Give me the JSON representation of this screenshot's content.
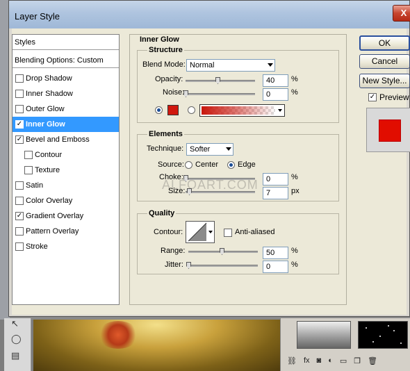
{
  "dialog": {
    "title": "Layer Style",
    "close_glyph": "X"
  },
  "styles_list": {
    "header": "Styles",
    "blending": "Blending Options: Custom",
    "items": [
      {
        "label": "Drop Shadow",
        "checked": false,
        "indent": false,
        "selected": false
      },
      {
        "label": "Inner Shadow",
        "checked": false,
        "indent": false,
        "selected": false
      },
      {
        "label": "Outer Glow",
        "checked": false,
        "indent": false,
        "selected": false
      },
      {
        "label": "Inner Glow",
        "checked": true,
        "indent": false,
        "selected": true
      },
      {
        "label": "Bevel and Emboss",
        "checked": true,
        "indent": false,
        "selected": false
      },
      {
        "label": "Contour",
        "checked": false,
        "indent": true,
        "selected": false
      },
      {
        "label": "Texture",
        "checked": false,
        "indent": true,
        "selected": false
      },
      {
        "label": "Satin",
        "checked": false,
        "indent": false,
        "selected": false
      },
      {
        "label": "Color Overlay",
        "checked": false,
        "indent": false,
        "selected": false
      },
      {
        "label": "Gradient Overlay",
        "checked": true,
        "indent": false,
        "selected": false
      },
      {
        "label": "Pattern Overlay",
        "checked": false,
        "indent": false,
        "selected": false
      },
      {
        "label": "Stroke",
        "checked": false,
        "indent": false,
        "selected": false
      }
    ]
  },
  "inner_glow": {
    "title": "Inner Glow",
    "structure": {
      "title": "Structure",
      "blend_mode_label": "Blend Mode:",
      "blend_mode_value": "Normal",
      "opacity_label": "Opacity:",
      "opacity_value": "40",
      "opacity_unit": "%",
      "opacity_slider": 0.4,
      "noise_label": "Noise:",
      "noise_value": "0",
      "noise_unit": "%",
      "noise_slider": 0,
      "color": "#d0180e",
      "color_radio_selected": true,
      "gradient_radio_selected": false
    },
    "elements": {
      "title": "Elements",
      "technique_label": "Technique:",
      "technique_value": "Softer",
      "source_label": "Source:",
      "source_center": "Center",
      "source_edge": "Edge",
      "source_selected": "Edge",
      "choke_label": "Choke:",
      "choke_value": "0",
      "choke_unit": "%",
      "choke_slider": 0,
      "size_label": "Size:",
      "size_value": "7",
      "size_unit": "px",
      "size_slider": 0.05
    },
    "quality": {
      "title": "Quality",
      "contour_label": "Contour:",
      "anti_aliased_label": "Anti-aliased",
      "anti_aliased_checked": false,
      "range_label": "Range:",
      "range_value": "50",
      "range_unit": "%",
      "range_slider": 0.5,
      "jitter_label": "Jitter:",
      "jitter_value": "0",
      "jitter_unit": "%",
      "jitter_slider": 0
    }
  },
  "buttons": {
    "ok": "OK",
    "cancel": "Cancel",
    "new_style": "New Style...",
    "preview_label": "Preview",
    "preview_checked": true,
    "preview_color": "#e10d00"
  },
  "watermark": "ALFOART.COM",
  "layers_panel": {
    "buttons": [
      "link-icon",
      "fx-icon",
      "mask-icon",
      "adjustment-icon",
      "group-icon",
      "new-layer-icon",
      "trash-icon"
    ],
    "fx_label": "fx"
  }
}
